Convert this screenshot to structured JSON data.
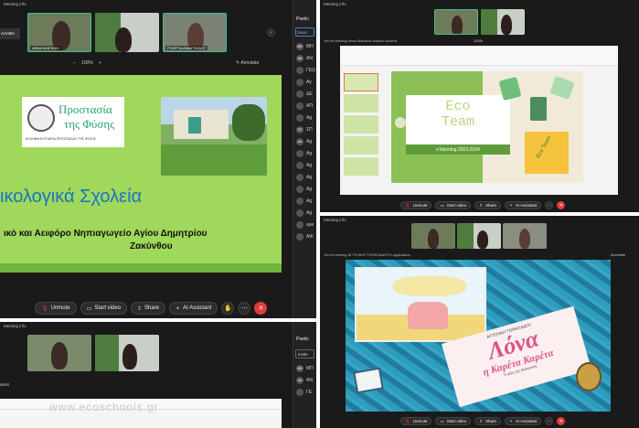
{
  "q1": {
    "title": "Meeting info",
    "left_label": "ΑΛΑΒΑ",
    "thumbs": [
      "ΑΝΝΑ ΜΑΡΙΟΣΗ",
      "",
      "ΓΕΩΡΓΙΑ ΑΝΑΣΤΑΣΙΟΥ"
    ],
    "zoom_minus": "−",
    "zoom_value": "100%",
    "zoom_plus": "+",
    "annotate": "Annotate",
    "slide": {
      "logo_line1": "Προστασία",
      "logo_line2": "της Φύσης",
      "logo_sub": "ΕΛΛΗΝΙΚΗ ΕΤΑΙΡΙΑ ΠΡΟΣΤΑΣΙΑΣ ΤΗΣ ΦΥΣΗΣ",
      "heading": "ικολογικά Σχολεία",
      "sub1": "ικό και Αειφόρο Νηπιαγωγείο Αγίου Δημητρίου",
      "sub2": "Ζακύνθου"
    },
    "controls": {
      "unmute": "Unmute",
      "start_video": "Start video",
      "share": "Share",
      "ai": "AI Assistant"
    },
    "participants": {
      "title": "Partic",
      "search": "Searc",
      "rows": [
        {
          "ini": "MB",
          "name": "ΜΗ"
        },
        {
          "ini": "AN",
          "name": "ΑΝ"
        },
        {
          "ini": "",
          "name": "ΓΕΩ"
        },
        {
          "ini": "",
          "name": "Αγ"
        },
        {
          "ini": "",
          "name": "ΔΕ"
        },
        {
          "ini": "",
          "name": "ΑΠ"
        },
        {
          "ini": "",
          "name": "Ag"
        },
        {
          "ini": "ΣΠ",
          "name": "ΣΠ"
        },
        {
          "ini": "AA",
          "name": "Ag"
        },
        {
          "ini": "",
          "name": "Ag"
        },
        {
          "ini": "",
          "name": "Ag"
        },
        {
          "ini": "",
          "name": "Ag"
        },
        {
          "ini": "",
          "name": "Ag"
        },
        {
          "ini": "",
          "name": "Ag"
        },
        {
          "ini": "",
          "name": "Ag"
        },
        {
          "ini": "",
          "name": "ape"
        },
        {
          "ini": "",
          "name": "Ath"
        }
      ]
    }
  },
  "q2": {
    "title": "Meeting info",
    "share_label": "You're viewing Anna Mariosi's shared content",
    "zoom": "100%",
    "slide_title1": "Eco",
    "slide_title2": "Team",
    "slide_sub": "eTwinning 2023-2024",
    "badge": "Eco Team",
    "controls": {
      "unmute": "Unmute",
      "start_video": "Start video",
      "share": "Share",
      "ai": "AI Assistant"
    }
  },
  "q3": {
    "title": "Meeting info",
    "left_label": "ident",
    "participants_title": "Partic",
    "invite": "Invite",
    "rows": [
      {
        "ini": "MB",
        "name": "ΜΠ"
      },
      {
        "ini": "AN",
        "name": "ΑΝ"
      },
      {
        "ini": "",
        "name": "ΓΕ"
      }
    ],
    "watermark": "www.ecoschools.gr"
  },
  "q4": {
    "title": "Meeting info",
    "share_label": "You're viewing ΑΓΓΕΛΙΚΗ ΤΟΡΑΣΙΑΔΟΥ's application",
    "annotate": "Annotate",
    "book_author": "ΑΓΓΕΛΙΚΗ ΤΟΡΑΣΙΑΔΟΥ",
    "book_title": "Λόνα",
    "book_sub": "η Καρέτα Καρέτα",
    "book_tag": "Η φίλη της θάλασσας",
    "controls": {
      "unmute": "Unmute",
      "start_video": "Start video",
      "share": "Share",
      "ai": "AI Assistant"
    }
  },
  "colors": {
    "slide_green": "#9fd85a",
    "eco_green": "#8dbf57",
    "sea": "#2a8fb0",
    "end_red": "#e23b3b"
  }
}
